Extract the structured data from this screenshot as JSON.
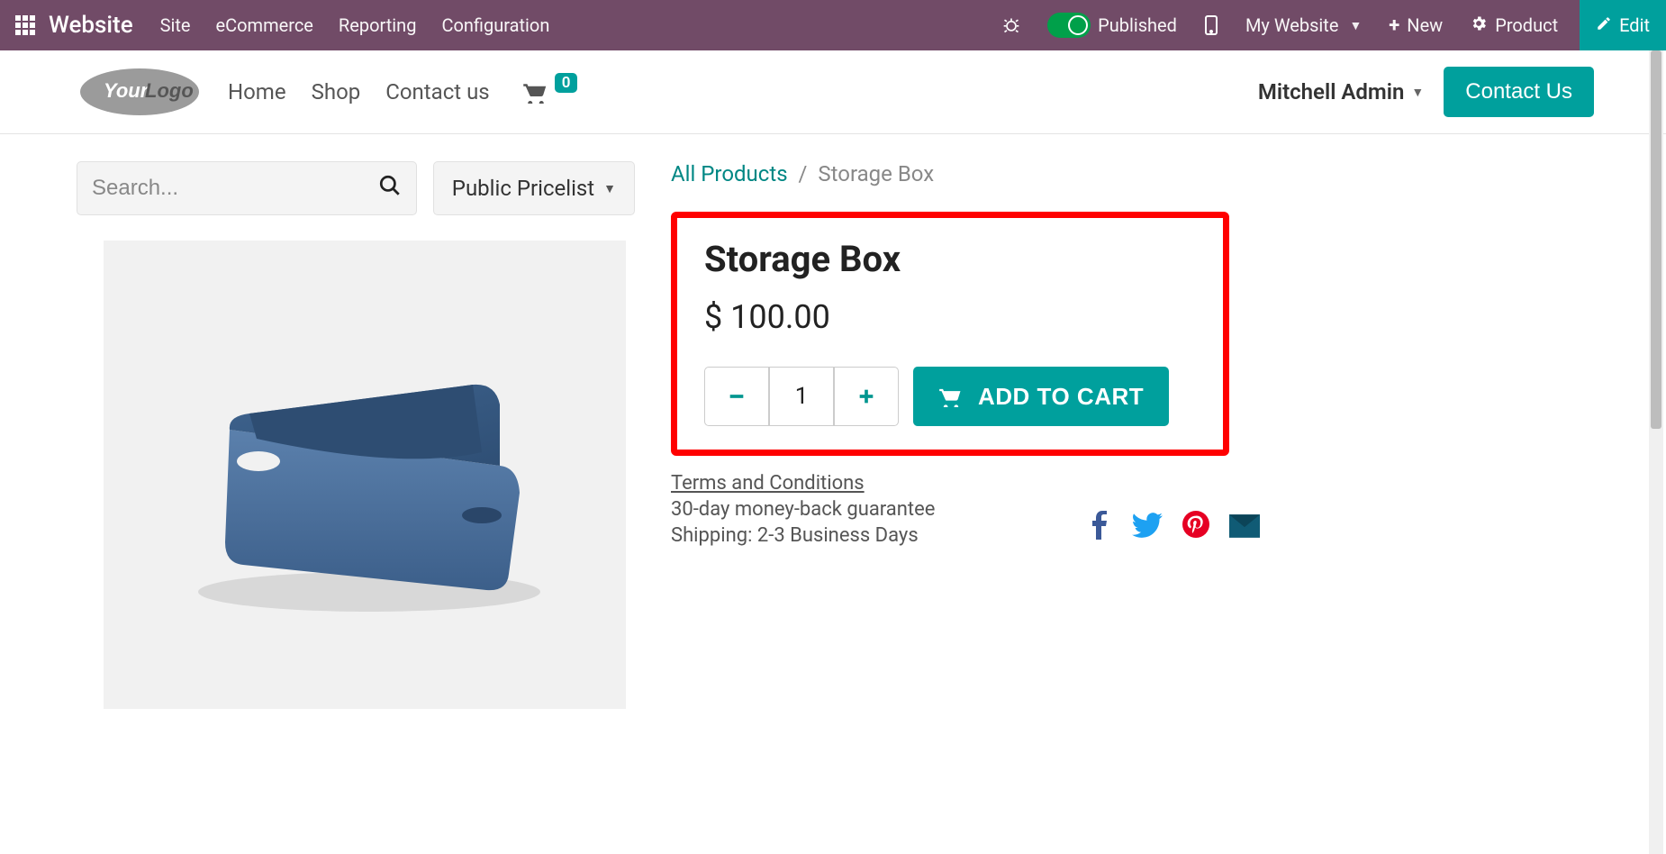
{
  "adminbar": {
    "brand": "Website",
    "menu": [
      "Site",
      "eCommerce",
      "Reporting",
      "Configuration"
    ],
    "published_label": "Published",
    "mywebsite_label": "My Website",
    "new_label": "New",
    "product_label": "Product",
    "edit_label": "Edit"
  },
  "site_header": {
    "logo_text_1": "Your",
    "logo_text_2": "Logo",
    "nav": [
      "Home",
      "Shop",
      "Contact us"
    ],
    "cart_count": "0",
    "user_name": "Mitchell Admin",
    "contact_btn": "Contact Us"
  },
  "search": {
    "placeholder": "Search...",
    "pricelist_label": "Public Pricelist"
  },
  "breadcrumb": {
    "root": "All Products",
    "current": "Storage Box"
  },
  "product": {
    "title": "Storage Box",
    "price": "$ 100.00",
    "qty": "1",
    "add_to_cart": "ADD TO CART",
    "terms_label": "Terms and Conditions",
    "guarantee": "30-day money-back guarantee",
    "shipping": "Shipping: 2-3 Business Days"
  }
}
